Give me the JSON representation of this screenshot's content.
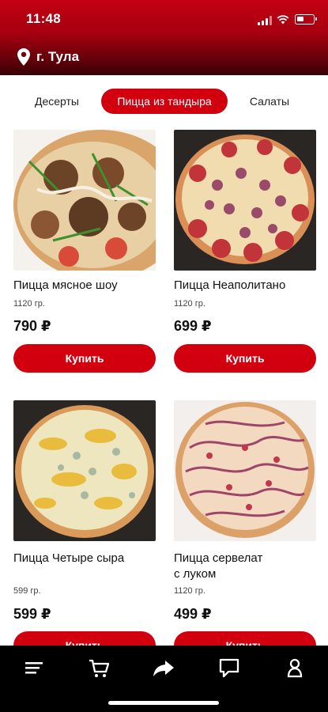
{
  "status_bar": {
    "time": "11:48"
  },
  "location": {
    "city": "г. Тула"
  },
  "categories": [
    {
      "label": "Десерты",
      "active": false
    },
    {
      "label": "Пицца из тандыра",
      "active": true
    },
    {
      "label": "Салаты",
      "active": false
    }
  ],
  "products": [
    {
      "title": "Пицца мясное шоу",
      "weight": "1120 гр.",
      "price": "790 ₽",
      "button": "Купить",
      "image": "meat-pizza-image"
    },
    {
      "title": "Пицца Неаполитано",
      "weight": "1120 гр.",
      "price": "699 ₽",
      "button": "Купить",
      "image": "napolitano-pizza-image"
    },
    {
      "title": "Пицца Четыре сыра",
      "weight": "599 гр.",
      "price": "599 ₽",
      "button": "Купить",
      "image": "four-cheese-pizza-image"
    },
    {
      "title": "Пицца сервелат\nс луком",
      "weight": "1120 гр.",
      "price": "499 ₽",
      "button": "Купить",
      "image": "servelat-pizza-image"
    }
  ],
  "bottom_nav": [
    {
      "icon": "menu-icon"
    },
    {
      "icon": "cart-icon"
    },
    {
      "icon": "share-icon"
    },
    {
      "icon": "chat-icon"
    },
    {
      "icon": "profile-icon"
    }
  ],
  "colors": {
    "accent": "#d2000f",
    "header_top": "#c30012",
    "header_bottom": "#3a0006",
    "nav_bg": "#000000"
  }
}
